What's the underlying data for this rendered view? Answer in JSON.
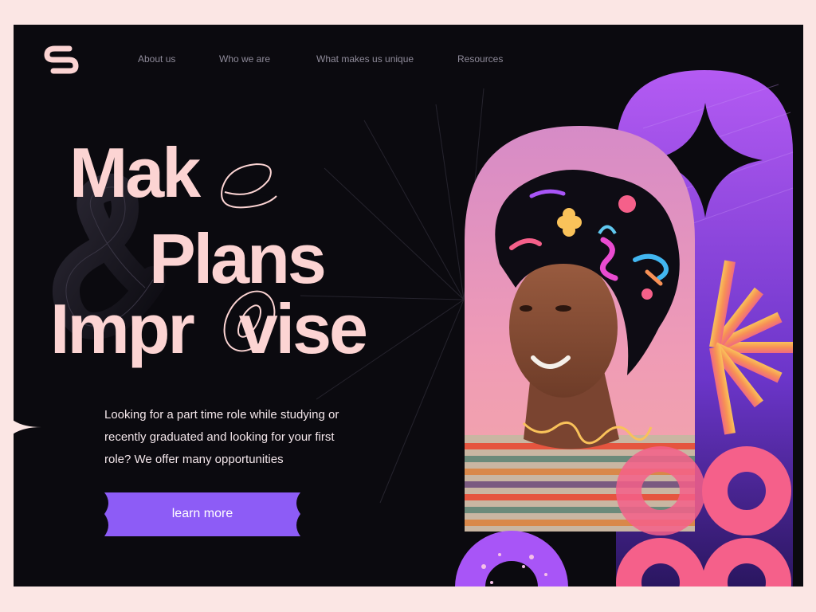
{
  "nav": {
    "items": [
      {
        "label": "About us"
      },
      {
        "label": "Who we are"
      },
      {
        "label": "What makes us unique"
      },
      {
        "label": "Resources"
      }
    ]
  },
  "hero": {
    "title_line_1": "Mak",
    "title_line_2": "Plans",
    "title_line_3": "Impr",
    "title_line_3_end": "vise",
    "description": "Looking for a part time role while studying or recently graduated and looking for your first role? We offer many opportunities",
    "cta_label": "learn more"
  },
  "colors": {
    "background": "#0b0a0f",
    "page_bg": "#fbe6e4",
    "title": "#fcd4d3",
    "cta": "#8d5cf6",
    "accent_pink": "#f5608a",
    "accent_purple": "#a855f7",
    "accent_orange": "#f7a44a"
  },
  "icons": [
    "brand-s-logo-icon",
    "ampersand-icon",
    "sparkle-star-icon",
    "sunburst-icon",
    "ring-icon"
  ]
}
